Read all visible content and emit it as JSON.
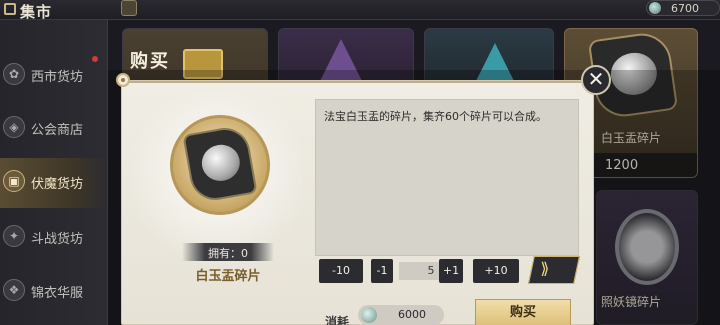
{
  "header": {
    "title": "集市",
    "currency_amount": "6700"
  },
  "sidebar": {
    "items": [
      {
        "label": "西市货坊",
        "icon": "flower-icon"
      },
      {
        "label": "公会商店",
        "icon": "guild-icon"
      },
      {
        "label": "伏魔货坊",
        "icon": "gift-icon",
        "active": true
      },
      {
        "label": "斗战货坊",
        "icon": "battle-icon"
      },
      {
        "label": "锦衣华服",
        "icon": "clothes-icon"
      }
    ]
  },
  "shop": {
    "cards": [
      {
        "name": "白玉盂碎片",
        "price": "1200"
      },
      {
        "name": "照妖镜碎片"
      }
    ]
  },
  "modal": {
    "title": "购买",
    "owned_label": "拥有：0",
    "item_name": "白玉盂碎片",
    "description": "法宝白玉盂的碎片，集齐60个碎片可以合成。",
    "qty_buttons": {
      "minus10": "-10",
      "minus1": "-1",
      "plus1": "+1",
      "plus10": "+10",
      "max": "⟫"
    },
    "quantity": "5",
    "cost_label": "消耗",
    "cost_amount": "6000",
    "buy_label": "购买",
    "close_label": "✕"
  },
  "colors": {
    "accent_gold": "#dcc07b",
    "panel_bg": "#f0ede4",
    "dark_button": "#2c2b30"
  }
}
